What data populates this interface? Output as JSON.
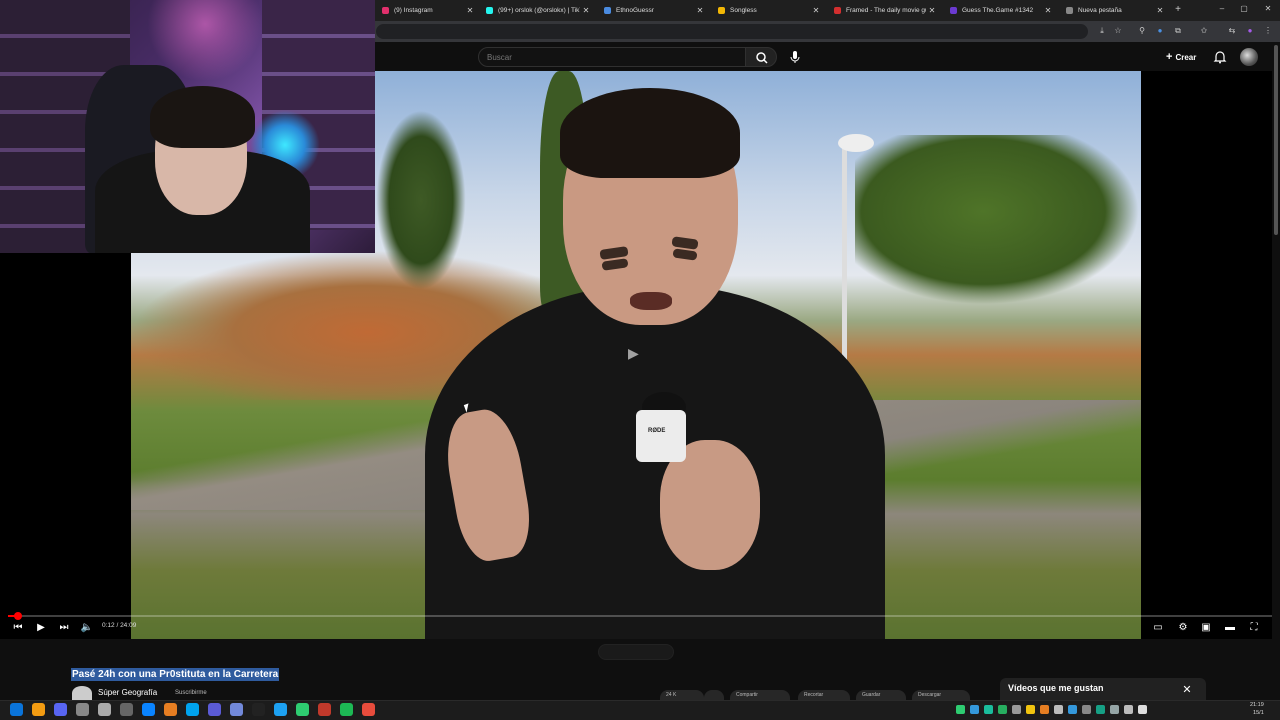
{
  "browser": {
    "tabs": [
      {
        "label": "(9) Instagram",
        "color": "#e1306c"
      },
      {
        "label": "(99+) orslok (@orslokx) | TikTo",
        "color": "#25f4ee"
      },
      {
        "label": "EthnoGuessr",
        "color": "#4a8be0"
      },
      {
        "label": "Songless",
        "color": "#f2b705"
      },
      {
        "label": "Framed - The daily movie gu",
        "color": "#d32f2f"
      },
      {
        "label": "Guess The.Game #1342",
        "color": "#6b3ad1"
      },
      {
        "label": "Nueva pestaña",
        "color": "#888888"
      }
    ],
    "new_tab": "+",
    "window_controls": [
      "–",
      "▢",
      "✕"
    ]
  },
  "header": {
    "search_placeholder": "Buscar",
    "create_label": "Crear"
  },
  "player": {
    "time": "0:12 / 24:09",
    "progress_fraction": 0.008,
    "mic_brand": "RØDE"
  },
  "video": {
    "title": "Pasé 24h con una Pr0stituta en la Carretera",
    "channel": "Súper Geografía",
    "subscribe_label": "Suscribirme",
    "actions": [
      "24 K",
      "",
      "Compartir",
      "Recortar",
      "Guardar",
      "Descargar"
    ]
  },
  "sidebar": {
    "liked_videos_title": "Vídeos que me gustan",
    "close": "✕"
  },
  "taskbar": {
    "time": "21:19",
    "date": "15/1"
  },
  "colors": {
    "accent": "#ff0000",
    "title_highlight": "#2f5b9e",
    "background": "#0f0f0f"
  }
}
